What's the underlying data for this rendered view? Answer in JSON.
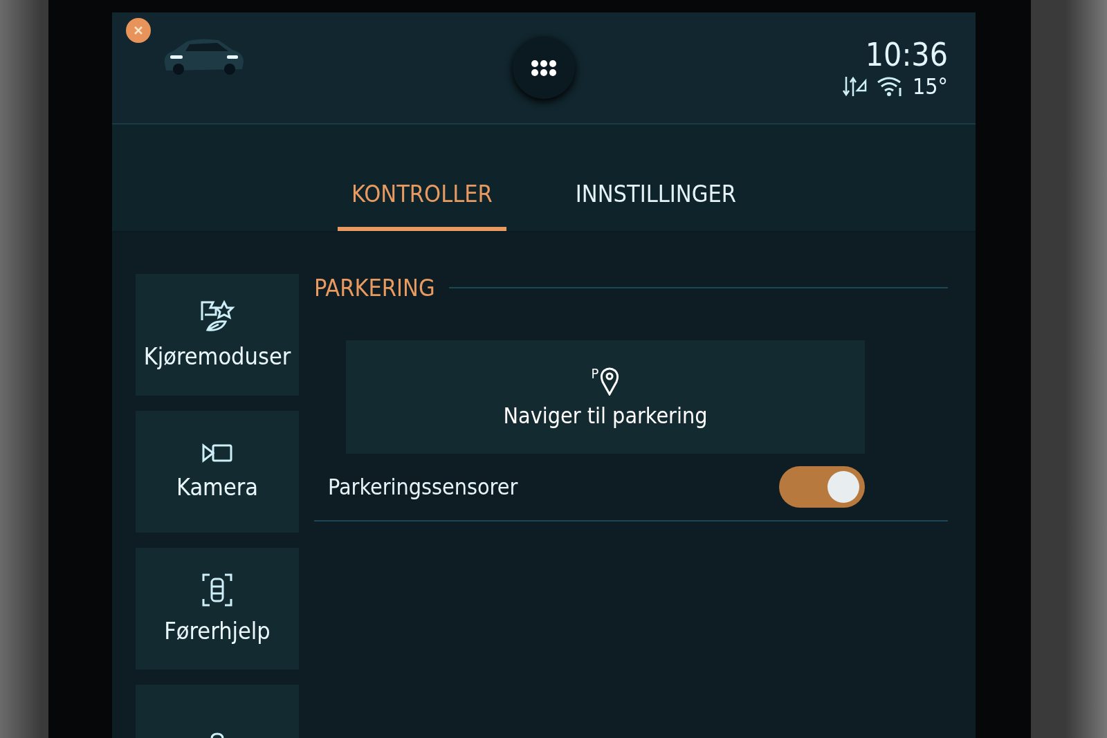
{
  "status_bar": {
    "time": "10:36",
    "temperature": "15°"
  },
  "tabs": [
    {
      "label": "KONTROLLER",
      "selected": true
    },
    {
      "label": "INNSTILLINGER",
      "selected": false
    }
  ],
  "sidebar": {
    "items": [
      {
        "kind": "modes",
        "label": "Kjøremoduser"
      },
      {
        "kind": "camera",
        "label": "Kamera"
      },
      {
        "kind": "assist",
        "label": "Førerhjelp"
      },
      {
        "kind": "lock"
      }
    ]
  },
  "section": {
    "title": "PARKERING",
    "action_button": {
      "icon_letter": "P",
      "label": "Naviger til parkering"
    },
    "settings": [
      {
        "label": "Parkeringssensorer",
        "on": true
      }
    ]
  }
}
